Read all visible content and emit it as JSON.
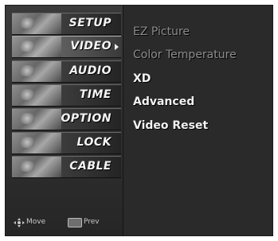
{
  "menu": {
    "items": [
      {
        "label": "SETUP"
      },
      {
        "label": "VIDEO"
      },
      {
        "label": "AUDIO"
      },
      {
        "label": "TIME"
      },
      {
        "label": "OPTION"
      },
      {
        "label": "LOCK"
      },
      {
        "label": "CABLE"
      }
    ],
    "active_index": 1
  },
  "submenu": {
    "items": [
      {
        "label": "EZ Picture",
        "enabled": false
      },
      {
        "label": "Color Temperature",
        "enabled": false
      },
      {
        "label": "XD",
        "enabled": true
      },
      {
        "label": "Advanced",
        "enabled": true
      },
      {
        "label": "Video Reset",
        "enabled": true
      }
    ]
  },
  "footer": {
    "move_label": "Move",
    "prev_label": "Prev",
    "move_icon": "move-arrows-icon",
    "prev_icon": "menu-key-icon"
  }
}
